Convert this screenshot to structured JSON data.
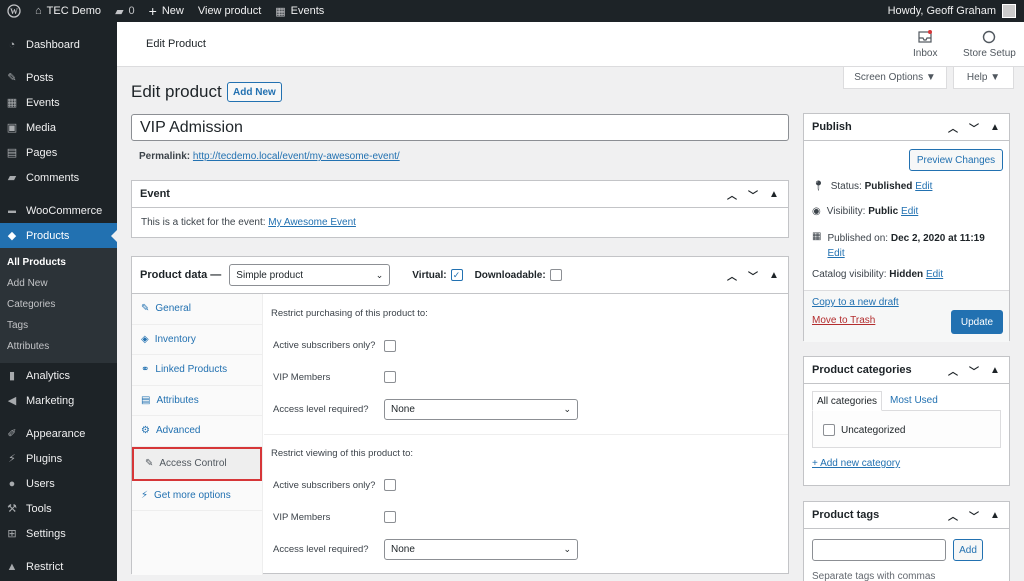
{
  "admin_bar": {
    "site_name": "TEC Demo",
    "comments_count": "0",
    "new_label": "New",
    "view_product": "View product",
    "events": "Events",
    "howdy": "Howdy, Geoff Graham"
  },
  "sidebar": {
    "items": [
      {
        "label": "Dashboard",
        "icon": "dashboard-icon"
      },
      {
        "label": "Posts",
        "icon": "pin-icon"
      },
      {
        "label": "Events",
        "icon": "calendar-icon"
      },
      {
        "label": "Media",
        "icon": "media-icon"
      },
      {
        "label": "Pages",
        "icon": "page-icon"
      },
      {
        "label": "Comments",
        "icon": "comment-icon"
      },
      {
        "label": "WooCommerce",
        "icon": "woo-icon"
      },
      {
        "label": "Products",
        "icon": "box-icon"
      },
      {
        "label": "Analytics",
        "icon": "bar-chart-icon"
      },
      {
        "label": "Marketing",
        "icon": "megaphone-icon"
      },
      {
        "label": "Appearance",
        "icon": "brush-icon"
      },
      {
        "label": "Plugins",
        "icon": "plug-icon"
      },
      {
        "label": "Users",
        "icon": "user-icon"
      },
      {
        "label": "Tools",
        "icon": "wrench-icon"
      },
      {
        "label": "Settings",
        "icon": "settings-icon"
      },
      {
        "label": "Restrict",
        "icon": "lock-icon"
      }
    ],
    "submenu": [
      "All Products",
      "Add New",
      "Categories",
      "Tags",
      "Attributes"
    ]
  },
  "header": {
    "title": "Edit Product",
    "inbox": "Inbox",
    "store_setup": "Store Setup"
  },
  "screen_options": "Screen Options ▼",
  "help": "Help ▼",
  "page": {
    "title": "Edit product",
    "add_new": "Add New",
    "product_title": "VIP Admission",
    "permalink_label": "Permalink:",
    "permalink_url": "http://tecdemo.local/event/my-awesome-event/"
  },
  "event_box": {
    "title": "Event",
    "text": "This is a ticket for the event:",
    "link": "My Awesome Event"
  },
  "product_data": {
    "title": "Product data —",
    "type": "Simple product",
    "virtual": "Virtual:",
    "downloadable": "Downloadable:",
    "tabs": [
      "General",
      "Inventory",
      "Linked Products",
      "Attributes",
      "Advanced",
      "Access Control",
      "Get more options"
    ],
    "restrict_purchase": "Restrict purchasing of this product to:",
    "restrict_view": "Restrict viewing of this product to:",
    "active_subs": "Active subscribers only?",
    "vip_members": "VIP Members",
    "access_level": "Access level required?",
    "none": "None"
  },
  "publish": {
    "title": "Publish",
    "preview": "Preview Changes",
    "status_label": "Status:",
    "status": "Published",
    "visibility_label": "Visibility:",
    "visibility": "Public",
    "published_on_label": "Published on:",
    "published_on": "Dec 2, 2020 at 11:19",
    "catalog_label": "Catalog visibility:",
    "catalog": "Hidden",
    "edit": "Edit",
    "copy_draft": "Copy to a new draft",
    "trash": "Move to Trash",
    "update": "Update"
  },
  "categories": {
    "title": "Product categories",
    "tab_all": "All categories",
    "tab_used": "Most Used",
    "item": "Uncategorized",
    "add": "+ Add new category"
  },
  "tags": {
    "title": "Product tags",
    "add": "Add",
    "hint": "Separate tags with commas"
  }
}
